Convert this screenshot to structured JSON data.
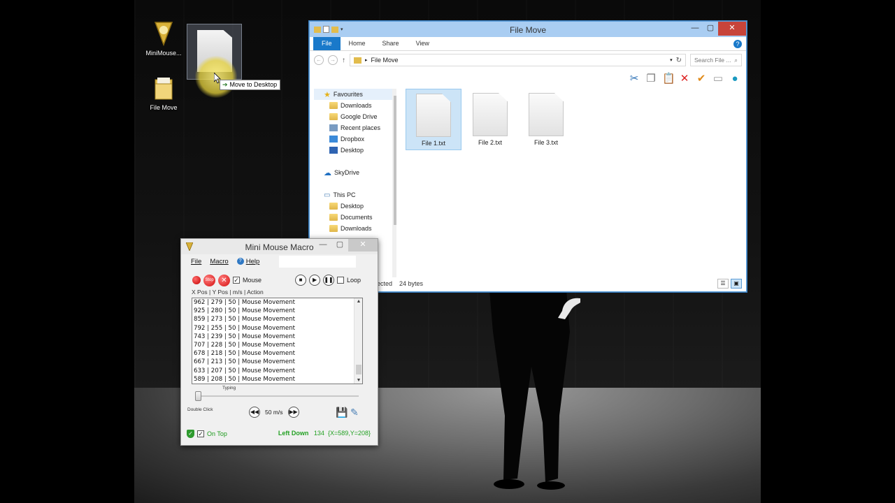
{
  "desktop": {
    "icons": [
      {
        "label": "MiniMouse...",
        "icon": "minimouse-logo-icon"
      },
      {
        "label": "File Move",
        "icon": "folder-icon"
      }
    ],
    "drag_tooltip": "Move to Desktop"
  },
  "explorer": {
    "title": "File Move",
    "tabs": [
      "File",
      "Home",
      "Share",
      "View"
    ],
    "address": "File Move",
    "search_placeholder": "Search File ...",
    "nav": {
      "favourites_label": "Favourites",
      "favourites": [
        "Downloads",
        "Google Drive",
        "Recent places",
        "Dropbox",
        "Desktop"
      ],
      "skydrive_label": "SkyDrive",
      "thispc_label": "This PC",
      "thispc": [
        "Desktop",
        "Documents",
        "Downloads"
      ]
    },
    "files": [
      {
        "name": "File 1.txt",
        "selected": true
      },
      {
        "name": "File 2.txt",
        "selected": false
      },
      {
        "name": "File 3.txt",
        "selected": false
      }
    ],
    "status_selected": "ected",
    "status_size": "24 bytes"
  },
  "macro": {
    "title": "Mini Mouse Macro",
    "menu": [
      "File",
      "Macro",
      "Help"
    ],
    "mouse_label": "Mouse",
    "stop_label": "Stop",
    "loop_label": "Loop",
    "columns_header": "X Pos  |  Y Pos  |  m/s  |  Action",
    "log_rows": [
      "962 | 279 | 50 | Mouse Movement",
      "925 | 280 | 50 | Mouse Movement",
      "859 | 273 | 50 | Mouse Movement",
      "792 | 255 | 50 | Mouse Movement",
      "743 | 239 | 50 | Mouse Movement",
      "707 | 228 | 50 | Mouse Movement",
      "678 | 218 | 50 | Mouse Movement",
      "667 | 213 | 50 | Mouse Movement",
      "633 | 207 | 50 | Mouse Movement",
      "589 | 208 | 50 | Mouse Movement"
    ],
    "typing_label": "Typing",
    "double_click_label": "Double Click",
    "speed": "50 m/s",
    "on_top_label": "On Top",
    "status_action": "Left Down",
    "status_count": "134",
    "status_coords": "{X=589,Y=208}"
  }
}
